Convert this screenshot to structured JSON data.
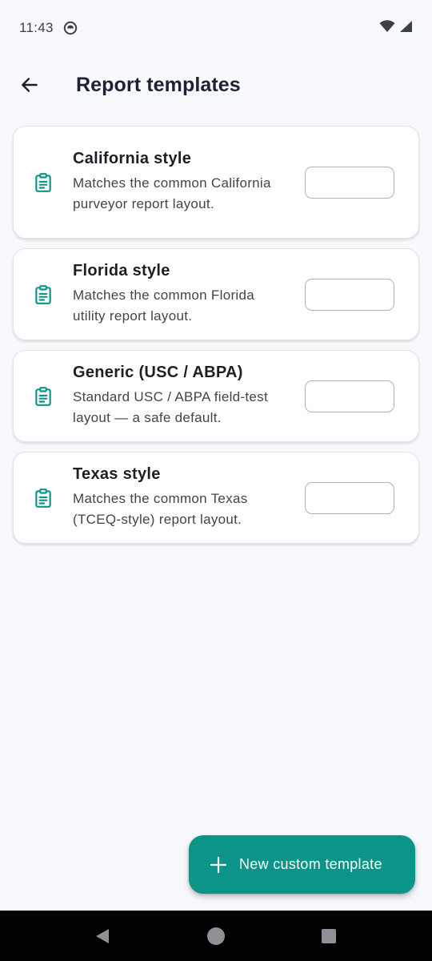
{
  "status_bar": {
    "time": "11:43",
    "icons": [
      "notification-icon",
      "wifi-icon",
      "signal-icon"
    ]
  },
  "app_bar": {
    "title": "Report templates",
    "back_icon": "arrow-left-icon"
  },
  "templates": [
    {
      "title": "California style",
      "description": "Matches the common California purveyor report layout.",
      "icon": "clipboard-icon"
    },
    {
      "title": "Florida style",
      "description": "Matches the common Florida utility report layout.",
      "icon": "clipboard-icon"
    },
    {
      "title": "Generic (USC / ABPA)",
      "description": "Standard USC / ABPA field-test layout — a safe default.",
      "icon": "clipboard-icon"
    },
    {
      "title": "Texas style",
      "description": "Matches the common Texas (TCEQ-style) report layout.",
      "icon": "clipboard-icon"
    }
  ],
  "fab": {
    "label": "New custom template",
    "icon": "plus-icon"
  },
  "colors": {
    "accent": "#0d9488",
    "background": "#f7f9fc",
    "card": "#ffffff",
    "title_text": "#1a2233"
  }
}
